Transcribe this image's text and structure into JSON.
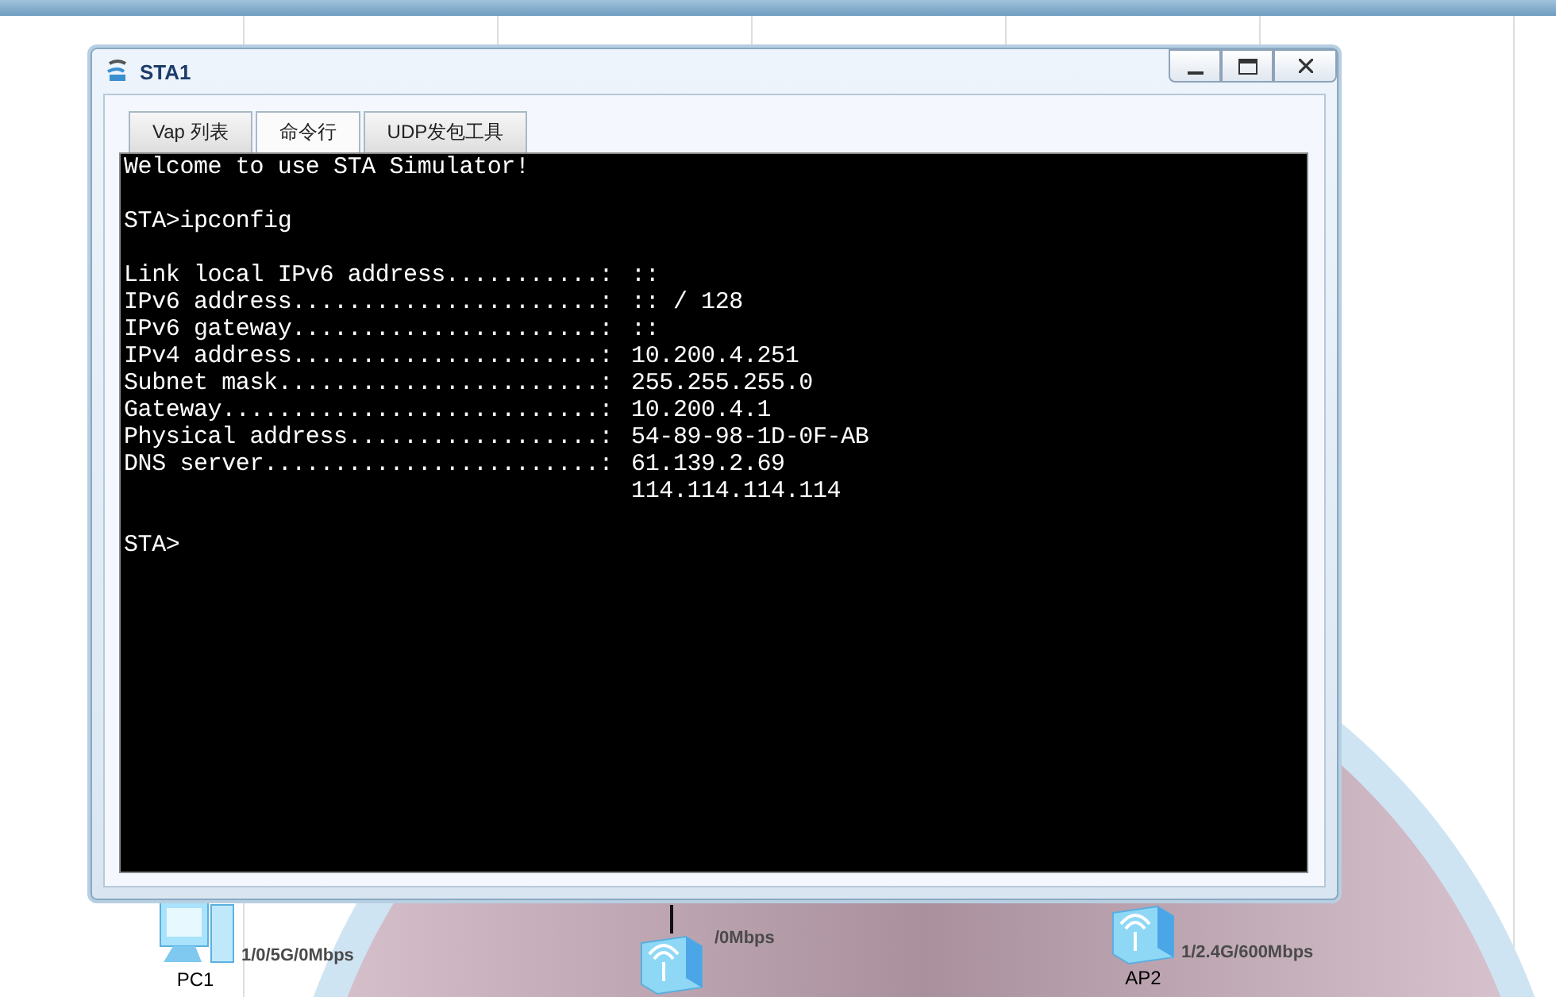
{
  "canvas": {
    "nodes": [
      {
        "kind": "pc",
        "name": "PC1",
        "link_label": "1/0/5G/0Mbps"
      },
      {
        "kind": "ap",
        "link_label": "/0Mbps"
      },
      {
        "kind": "ap",
        "name": "AP2",
        "link_label": "1/2.4G/600Mbps"
      }
    ]
  },
  "window": {
    "title": "STA1",
    "tabs": [
      {
        "label": "Vap 列表",
        "selected": false
      },
      {
        "label": "命令行",
        "selected": true
      },
      {
        "label": "UDP发包工具",
        "selected": false
      }
    ],
    "terminal": {
      "intro": [
        "Welcome to use STA Simulator!"
      ],
      "command": "STA>ipconfig",
      "rows": [
        {
          "label": "Link local IPv6 address...........:",
          "value": "::"
        },
        {
          "label": "IPv6 address......................:",
          "value": ":: / 128"
        },
        {
          "label": "IPv6 gateway......................:",
          "value": "::"
        },
        {
          "label": "IPv4 address......................:",
          "value": "10.200.4.251"
        },
        {
          "label": "Subnet mask.......................:",
          "value": "255.255.255.0"
        },
        {
          "label": "Gateway...........................:",
          "value": "10.200.4.1"
        },
        {
          "label": "Physical address..................:",
          "value": "54-89-98-1D-0F-AB"
        },
        {
          "label": "DNS server........................:",
          "value": "61.139.2.69"
        },
        {
          "value": "114.114.114.114"
        }
      ],
      "prompt": "STA>"
    }
  }
}
